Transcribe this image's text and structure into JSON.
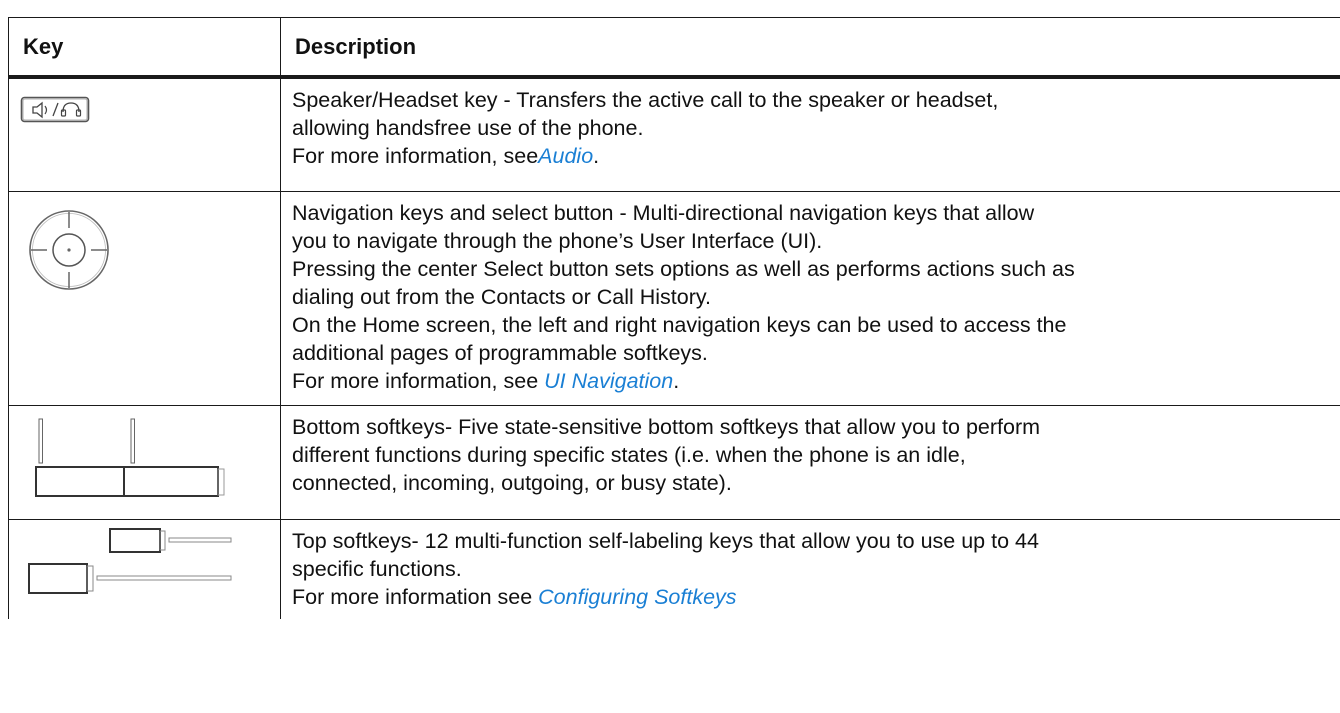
{
  "header": {
    "key": "Key",
    "description": "Description"
  },
  "rows": [
    {
      "icon": "speaker-headset-key-icon",
      "lines": [
        " Speaker/Headset key - Transfers the active call to the speaker or headset,",
        "allowing handsfree use of the phone."
      ],
      "more_prefix": "For more information, see",
      "link": "Audio",
      "more_suffix": "."
    },
    {
      "icon": "navigation-keys-icon",
      "lines": [
        " Navigation keys and select button - Multi-directional navigation keys that allow",
        "you to navigate through the phone’s User Interface (UI).",
        "Pressing the center Select button sets options as well as performs actions such as",
        "dialing out from the Contacts or Call History.",
        "On the Home screen, the left and right navigation keys can be used to access the",
        "additional pages of programmable softkeys."
      ],
      "more_prefix": "For more information, see ",
      "link": "UI Navigation",
      "more_suffix": "."
    },
    {
      "icon": "bottom-softkeys-icon",
      "lines": [
        "Bottom softkeys- Five state-sensitive bottom softkeys that allow you to perform",
        "different functions during specific states (i.e. when the phone is an idle,",
        "connected, incoming, outgoing, or busy state)."
      ]
    },
    {
      "icon": "top-softkeys-icon",
      "lines": [
        "Top softkeys- 12 multi-function self-labeling keys that allow you to use up to 44",
        "specific functions."
      ],
      "more_prefix": "For more information see ",
      "link": "Configuring Softkeys",
      "more_suffix": ""
    }
  ]
}
